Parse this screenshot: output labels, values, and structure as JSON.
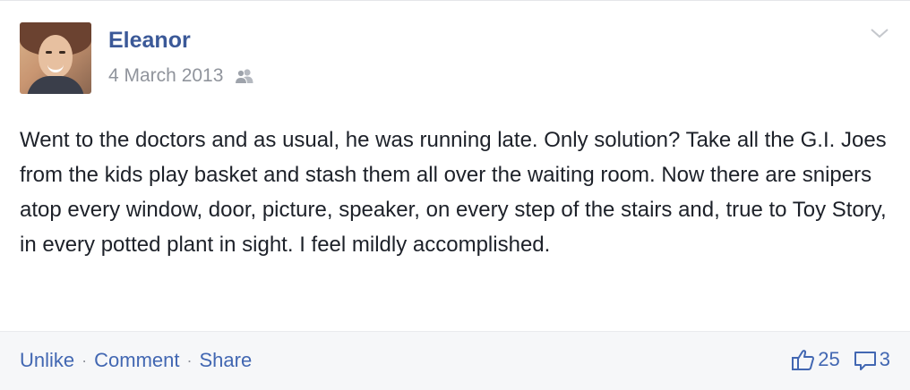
{
  "post": {
    "author": "Eleanor",
    "date": "4 March 2013",
    "audience_icon": "friends-icon",
    "text": "Went to the doctors and as usual, he was running late. Only solution? Take all the G.I. Joes from the kids play basket and stash them all over the waiting room. Now there are snipers atop every window, door, picture, speaker, on every step of the stairs and, true to Toy Story, in every potted plant in sight. I feel mildly accomplished."
  },
  "actions": {
    "unlike": "Unlike",
    "comment": "Comment",
    "share": "Share",
    "separator": "·"
  },
  "stats": {
    "likes": "25",
    "comments": "3"
  },
  "colors": {
    "link": "#3b5998",
    "action": "#4267b2",
    "meta": "#90949c",
    "text": "#1d2129",
    "footer_bg": "#f6f7f9"
  }
}
